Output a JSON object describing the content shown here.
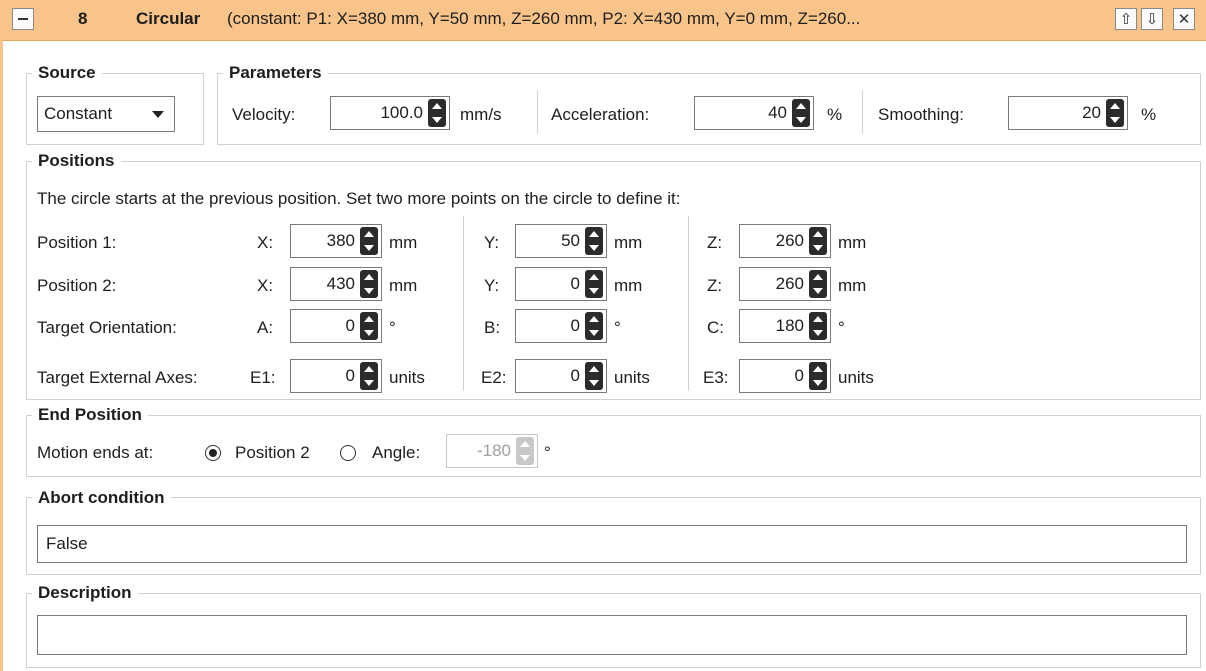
{
  "header": {
    "number": "8",
    "title": "Circular",
    "summary": "(constant: P1: X=380 mm, Y=50 mm, Z=260 mm, P2: X=430 mm, Y=0 mm, Z=260...",
    "icons": {
      "collapse": "collapse-icon",
      "up": "arrow-up-icon",
      "down": "arrow-down-icon",
      "close": "close-icon"
    },
    "up_glyph": "⇧",
    "down_glyph": "⇩",
    "close_glyph": "✕"
  },
  "source": {
    "title": "Source",
    "value": "Constant"
  },
  "parameters": {
    "title": "Parameters",
    "velocity": {
      "label": "Velocity:",
      "value": "100.0",
      "unit": "mm/s"
    },
    "acceleration": {
      "label": "Acceleration:",
      "value": "40",
      "unit": "%"
    },
    "smoothing": {
      "label": "Smoothing:",
      "value": "20",
      "unit": "%"
    }
  },
  "positions": {
    "title": "Positions",
    "description": "The circle starts at the previous position. Set two more points on the circle to define it:",
    "rows": [
      {
        "label": "Position 1:",
        "fields": [
          {
            "axis": "X:",
            "value": "380",
            "unit": "mm"
          },
          {
            "axis": "Y:",
            "value": "50",
            "unit": "mm"
          },
          {
            "axis": "Z:",
            "value": "260",
            "unit": "mm"
          }
        ]
      },
      {
        "label": "Position 2:",
        "fields": [
          {
            "axis": "X:",
            "value": "430",
            "unit": "mm"
          },
          {
            "axis": "Y:",
            "value": "0",
            "unit": "mm"
          },
          {
            "axis": "Z:",
            "value": "260",
            "unit": "mm"
          }
        ]
      },
      {
        "label": "Target Orientation:",
        "fields": [
          {
            "axis": "A:",
            "value": "0",
            "unit": "°"
          },
          {
            "axis": "B:",
            "value": "0",
            "unit": "°"
          },
          {
            "axis": "C:",
            "value": "180",
            "unit": "°"
          }
        ]
      },
      {
        "label": "Target External Axes:",
        "fields": [
          {
            "axis": "E1:",
            "value": "0",
            "unit": "units"
          },
          {
            "axis": "E2:",
            "value": "0",
            "unit": "units"
          },
          {
            "axis": "E3:",
            "value": "0",
            "unit": "units"
          }
        ]
      }
    ]
  },
  "end_position": {
    "title": "End Position",
    "label": "Motion ends at:",
    "option1": "Position 2",
    "option2": "Angle:",
    "selected": "Position 2",
    "angle_value": "-180",
    "angle_unit": "°"
  },
  "abort": {
    "title": "Abort condition",
    "value": "False"
  },
  "description": {
    "title": "Description",
    "value": ""
  }
}
